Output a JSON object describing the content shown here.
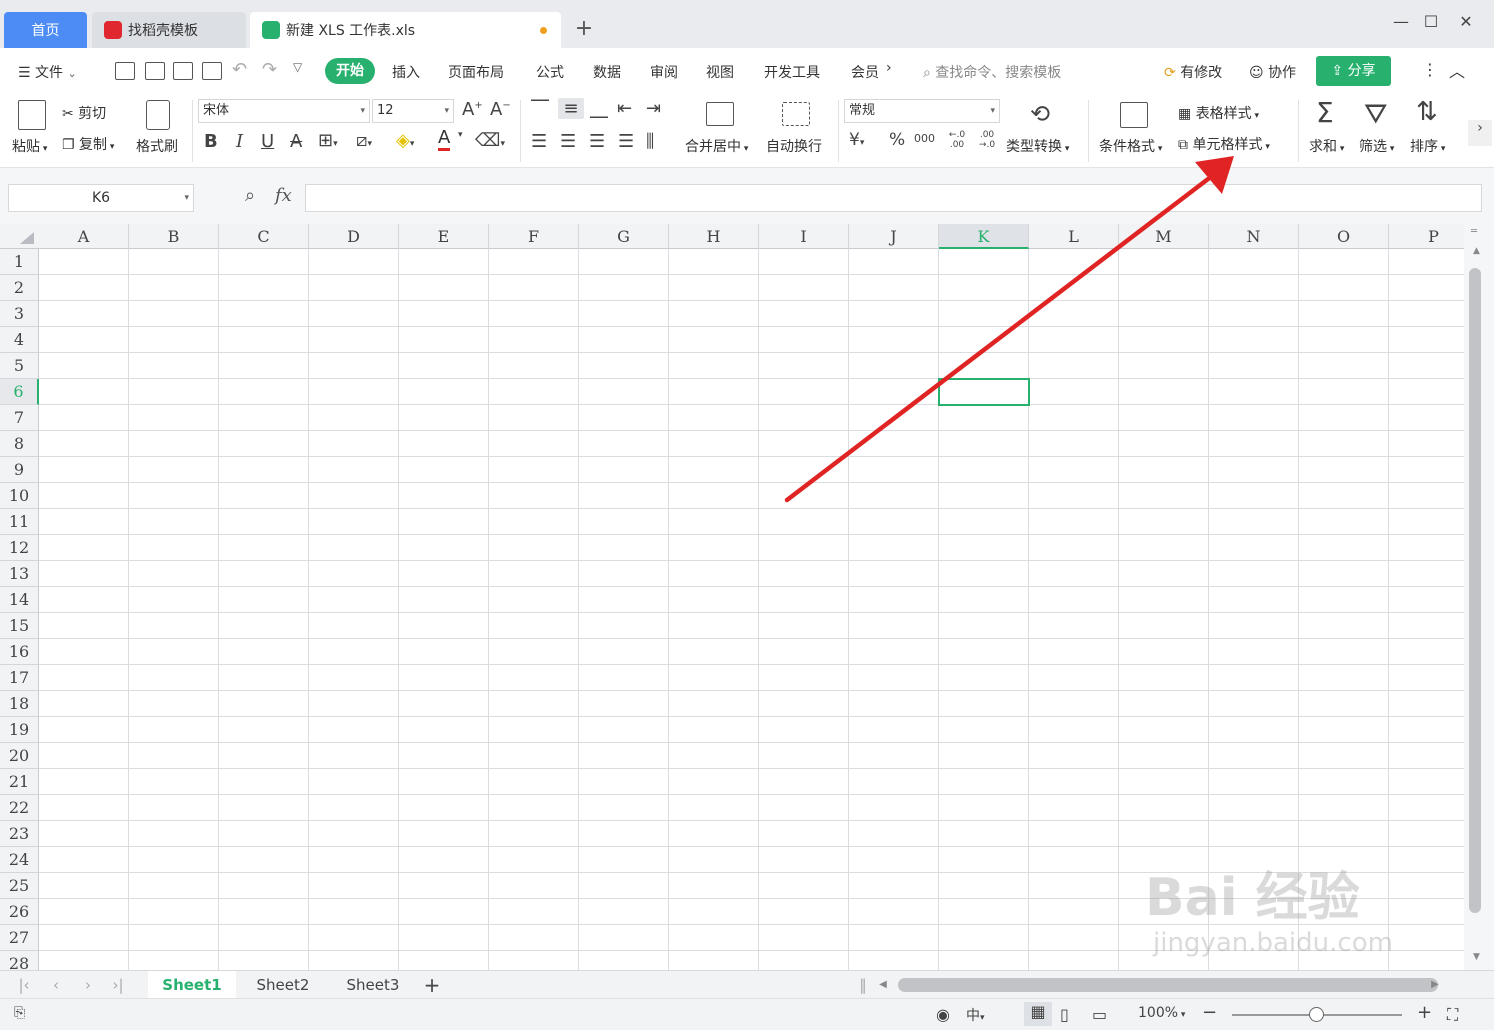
{
  "tabs": {
    "home": "首页",
    "templates": "找稻壳模板",
    "file": "新建 XLS 工作表.xls"
  },
  "menu": {
    "file": "文件",
    "items": [
      "开始",
      "插入",
      "页面布局",
      "公式",
      "数据",
      "审阅",
      "视图",
      "开发工具",
      "会员"
    ],
    "search_placeholder": "查找命令、搜索模板",
    "modified": "有修改",
    "collab": "协作",
    "share": "分享"
  },
  "toolbar": {
    "paste": "粘贴",
    "cut": "剪切",
    "copy": "复制",
    "format_painter": "格式刷",
    "font_name": "宋体",
    "font_size": "12",
    "merge_center": "合并居中",
    "wrap_text": "自动换行",
    "number_format": "常规",
    "type_convert": "类型转换",
    "conditional_format": "条件格式",
    "table_style": "表格样式",
    "cell_style": "单元格样式",
    "sum": "求和",
    "filter": "筛选",
    "sort": "排序",
    "currency_symbol": "¥",
    "percent_symbol": "%",
    "thousands": "000",
    "inc_decimal": "←.0 .00",
    "dec_decimal": ".00 →.0"
  },
  "formula": {
    "name_box": "K6",
    "fx": "fx",
    "value": ""
  },
  "grid": {
    "columns": [
      "A",
      "B",
      "C",
      "D",
      "E",
      "F",
      "G",
      "H",
      "I",
      "J",
      "K",
      "L",
      "M",
      "N",
      "O",
      "P"
    ],
    "rows": [
      "1",
      "2",
      "3",
      "4",
      "5",
      "6",
      "7",
      "8",
      "9",
      "10",
      "11",
      "12",
      "13",
      "14",
      "15",
      "16",
      "17",
      "18",
      "19",
      "20",
      "21",
      "22",
      "23",
      "24",
      "25",
      "26",
      "27",
      "28"
    ],
    "active_column": "K",
    "active_row": "6"
  },
  "sheets": [
    "Sheet1",
    "Sheet2",
    "Sheet3"
  ],
  "status": {
    "zoom": "100%"
  },
  "colors": {
    "accent": "#27b06e",
    "home_tab": "#4d8cf5",
    "arrow": "#e02424"
  },
  "watermark": {
    "brand": "Bai 经验",
    "url": "jingyan.baidu.com"
  }
}
